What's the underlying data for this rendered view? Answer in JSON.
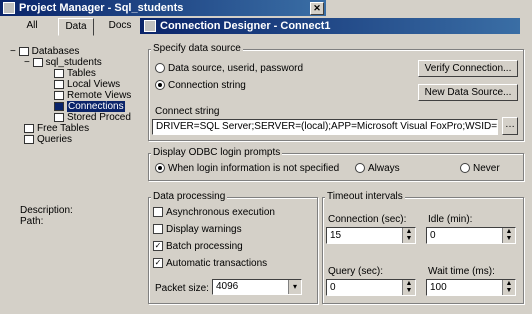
{
  "project_manager": {
    "title": "Project Manager - Sql_students",
    "tabs": [
      "All",
      "Data",
      "Docs"
    ],
    "tree": {
      "databases": "Databases",
      "db": "sql_students",
      "tables": "Tables",
      "local_views": "Local Views",
      "remote_views": "Remote Views",
      "connections": "Connections",
      "stored_proc": "Stored Proced",
      "free_tables": "Free Tables",
      "queries": "Queries"
    },
    "description_label": "Description:",
    "path_label": "Path:"
  },
  "dialog": {
    "title": "Connection Designer - Connect1",
    "specify_source_label": "Specify data source",
    "radio_datasource": "Data source, userid, password",
    "radio_connstring": "Connection string",
    "verify_button": "Verify Connection...",
    "new_ds_button": "New Data Source...",
    "connect_string_label": "Connect string",
    "connect_string_value": "DRIVER=SQL Server;SERVER=(local);APP=Microsoft Visual FoxPro;WSID=LYSN_ANG",
    "odbc_label": "Display ODBC login prompts",
    "radio_when": "When login information is not specified",
    "radio_always": "Always",
    "radio_never": "Never",
    "data_processing_label": "Data processing",
    "chk_async": "Asynchronous execution",
    "chk_warnings": "Display warnings",
    "chk_batch": "Batch processing",
    "chk_auto": "Automatic transactions",
    "packet_label": "Packet size:",
    "packet_value": "4096",
    "timeout_label": "Timeout intervals",
    "conn_sec_label": "Connection (sec):",
    "conn_sec_value": "15",
    "idle_label": "Idle (min):",
    "idle_value": "0",
    "query_label": "Query (sec):",
    "query_value": "0",
    "wait_label": "Wait time (ms):",
    "wait_value": "100"
  }
}
